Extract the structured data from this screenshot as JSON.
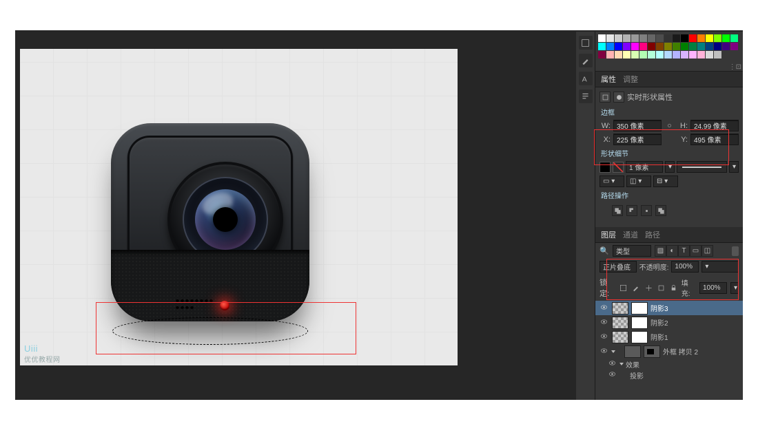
{
  "watermark": {
    "brand": "Uiii",
    "sub": "优优教程网"
  },
  "panels": {
    "props_tabs": [
      "属性",
      "调整"
    ],
    "props_title": "实时形状属性",
    "bounds_caption": "边框",
    "bounds": {
      "w_label": "W:",
      "w": "350 像素",
      "h_label": "H:",
      "h": "24.99 像素",
      "x_label": "X:",
      "x": "225 像素",
      "y_label": "Y:",
      "y": "495 像素"
    },
    "shape_details_caption": "形状细节",
    "stroke_width": "1 像素",
    "path_ops_caption": "路径操作",
    "layer_tabs": [
      "图层",
      "通道",
      "路径"
    ],
    "filter_label": "类型",
    "blend": {
      "mode": "正片叠底",
      "opacity_label": "不透明度:",
      "opacity": "100%",
      "fill_label": "填充:",
      "fill": "100%"
    },
    "lock_label": "锁定:",
    "layers": [
      {
        "name": "阴影3",
        "selected": true
      },
      {
        "name": "阴影2",
        "selected": false
      },
      {
        "name": "阴影1",
        "selected": false
      },
      {
        "name": "外框 拷贝 2",
        "selected": false,
        "shape": true
      }
    ],
    "fx": {
      "label": "效果",
      "item": "投影"
    }
  },
  "swatch_colors": [
    "#fff",
    "#e6e6e6",
    "#ccc",
    "#b3b3b3",
    "#999",
    "#808080",
    "#666",
    "#4d4d4d",
    "#333",
    "#1a1a1a",
    "#000",
    "#f00",
    "#ff8000",
    "#ff0",
    "#80ff00",
    "#0f0",
    "#00ff80",
    "#0ff",
    "#0080ff",
    "#00f",
    "#8000ff",
    "#f0f",
    "#ff0080",
    "#800000",
    "#804000",
    "#808000",
    "#408000",
    "#008000",
    "#008040",
    "#008080",
    "#004080",
    "#000080",
    "#400080",
    "#800080",
    "#800040",
    "#ffb3b3",
    "#ffd9b3",
    "#ffffb3",
    "#d9ffb3",
    "#b3ffb3",
    "#b3ffd9",
    "#b3ffff",
    "#b3d9ff",
    "#b3b3ff",
    "#d9b3ff",
    "#ffb3ff",
    "#ffb3d9",
    "#d9d9d9",
    "#bfbfbf"
  ]
}
